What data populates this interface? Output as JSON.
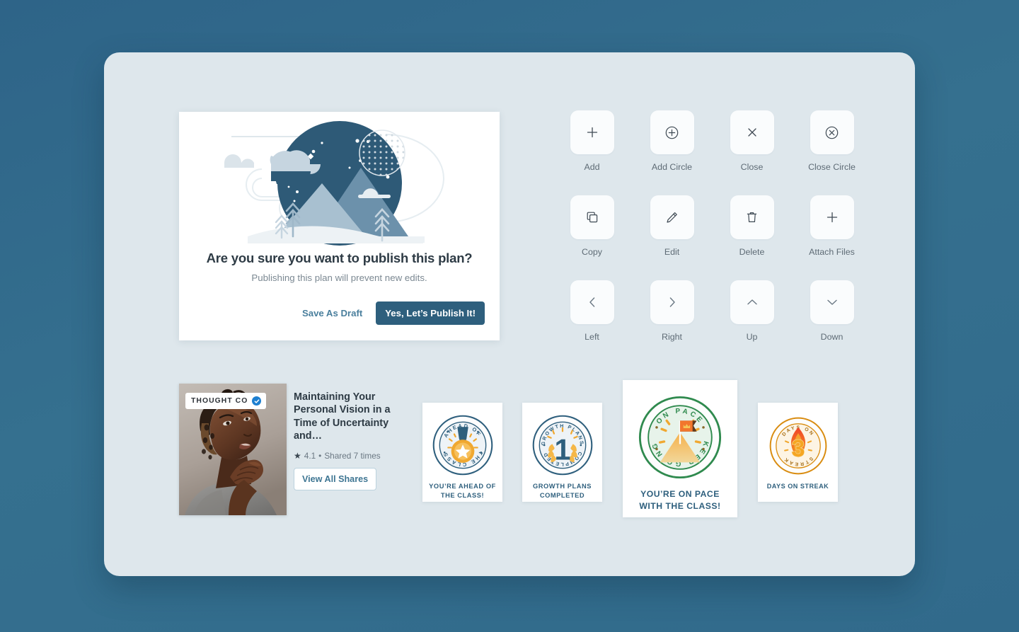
{
  "theme": {
    "page_background": "#33698b",
    "canvas_background": "#dee7ec",
    "accent_blue": "#2e5f7d",
    "link_blue": "#4a7f9d",
    "gold": "#f0a830",
    "green": "#2f8a4e",
    "orange": "#e8641a"
  },
  "dialog": {
    "illustration": "night-mountain-illustration",
    "title": "Are you sure you want to publish this plan?",
    "subtitle": "Publishing this plan will prevent new edits.",
    "secondary_action": "Save As Draft",
    "primary_action": "Yes, Let’s Publish It!"
  },
  "icon_grid": {
    "items": [
      {
        "label": "Add",
        "icon": "plus-icon"
      },
      {
        "label": "Add Circle",
        "icon": "plus-circle-icon"
      },
      {
        "label": "Close",
        "icon": "close-icon"
      },
      {
        "label": "Close Circle",
        "icon": "close-circle-icon"
      },
      {
        "label": "Copy",
        "icon": "copy-icon"
      },
      {
        "label": "Edit",
        "icon": "pencil-icon"
      },
      {
        "label": "Delete",
        "icon": "trash-icon"
      },
      {
        "label": "Attach Files",
        "icon": "plus-icon"
      },
      {
        "label": "Left",
        "icon": "chevron-left-icon"
      },
      {
        "label": "Right",
        "icon": "chevron-right-icon"
      },
      {
        "label": "Up",
        "icon": "chevron-up-icon"
      },
      {
        "label": "Down",
        "icon": "chevron-down-icon"
      }
    ]
  },
  "article_card": {
    "publisher": "THOUGHT CO",
    "verified": true,
    "title": "Maintaining Your Personal Vision in a Time of Uncertainty and…",
    "rating": "4.1",
    "separator": "•",
    "shares_text": "Shared 7 times",
    "button_label": "View All Shares",
    "photo_alt": "woman-looking-up-photo"
  },
  "badges": [
    {
      "id": "ahead-of-class",
      "art": "medal-badge",
      "ring_top_text": "AHEAD OF",
      "ring_bottom_text": "THE CLASS",
      "caption": "YOU’RE AHEAD OF\nTHE CLASS!",
      "caption_line1": "YOU’RE AHEAD OF",
      "caption_line2": "THE CLASS!",
      "color": "#2e5f7d"
    },
    {
      "id": "growth-plans",
      "art": "laurel-number-badge",
      "ring_top_text": "GROWTH PLANS",
      "ring_bottom_text": "COMPLETED",
      "number": "1",
      "caption_line1": "GROWTH PLANS",
      "caption_line2": "COMPLETED",
      "color": "#2e5f7d"
    },
    {
      "id": "on-pace",
      "art": "mountain-flag-badge",
      "ring_top_text": "ON PACE",
      "ring_bottom_text": "KEEP GOING",
      "caption_line1": "YOU’RE ON PACE",
      "caption_line2": "WITH THE CLASS!",
      "color": "#2e5f7d",
      "ring_color": "#2f8a4e"
    },
    {
      "id": "days-on-streak",
      "art": "flame-number-badge",
      "ring_top_text": "DAYS ON",
      "ring_bottom_text": "STREAK",
      "number": "3",
      "caption_line1": "DAYS ON STREAK",
      "caption_line2": "",
      "color": "#2e5f7d",
      "ring_color": "#d98c10"
    }
  ]
}
